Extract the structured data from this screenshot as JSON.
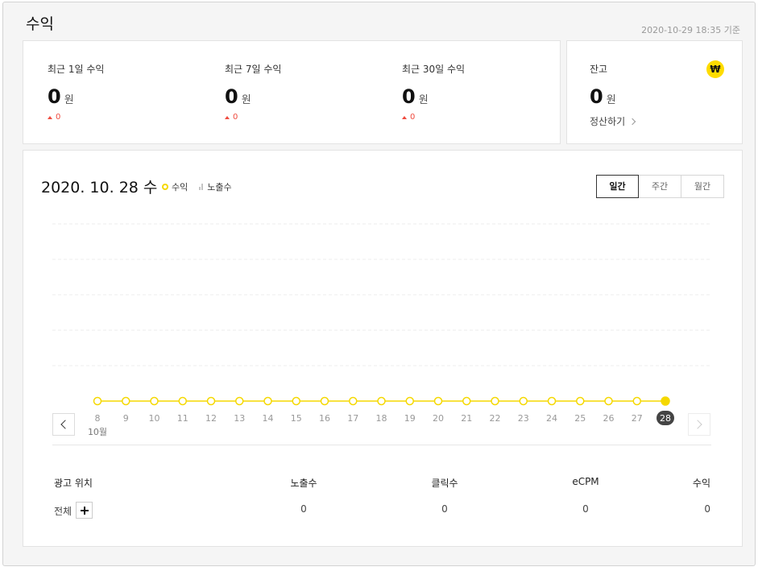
{
  "header": {
    "title": "수익",
    "timestamp": "2020-10-29 18:35 기준"
  },
  "summary": [
    {
      "label": "최근 1일 수익",
      "value": "0",
      "unit": "원",
      "delta": "0"
    },
    {
      "label": "최근 7일 수익",
      "value": "0",
      "unit": "원",
      "delta": "0"
    },
    {
      "label": "최근 30일 수익",
      "value": "0",
      "unit": "원",
      "delta": "0"
    }
  ],
  "balance": {
    "label": "잔고",
    "value": "0",
    "unit": "원",
    "settle_link": "정산하기",
    "won_icon_glyph": "₩"
  },
  "chart_header": {
    "date": "2020. 10. 28 수",
    "legend_revenue": "수익",
    "legend_impressions": "노출수",
    "tabs": [
      "일간",
      "주간",
      "월간"
    ],
    "active_tab": "일간"
  },
  "chart_data": {
    "type": "line",
    "x": [
      "8",
      "9",
      "10",
      "11",
      "12",
      "13",
      "14",
      "15",
      "16",
      "17",
      "18",
      "19",
      "20",
      "21",
      "22",
      "23",
      "24",
      "25",
      "26",
      "27",
      "28"
    ],
    "month_label": "10월",
    "selected": "28",
    "series": [
      {
        "name": "수익",
        "values": [
          0,
          0,
          0,
          0,
          0,
          0,
          0,
          0,
          0,
          0,
          0,
          0,
          0,
          0,
          0,
          0,
          0,
          0,
          0,
          0,
          0
        ],
        "color": "#f5d800"
      }
    ],
    "grid": true
  },
  "table": {
    "headers": [
      "광고 위치",
      "노출수",
      "클릭수",
      "eCPM",
      "수익"
    ],
    "rows": [
      {
        "position": "전체",
        "impressions": "0",
        "clicks": "0",
        "ecpm": "0",
        "revenue": "0"
      }
    ]
  },
  "colors": {
    "accent": "#f5d800",
    "delta": "#ef4b3f",
    "badge": "#444444"
  }
}
